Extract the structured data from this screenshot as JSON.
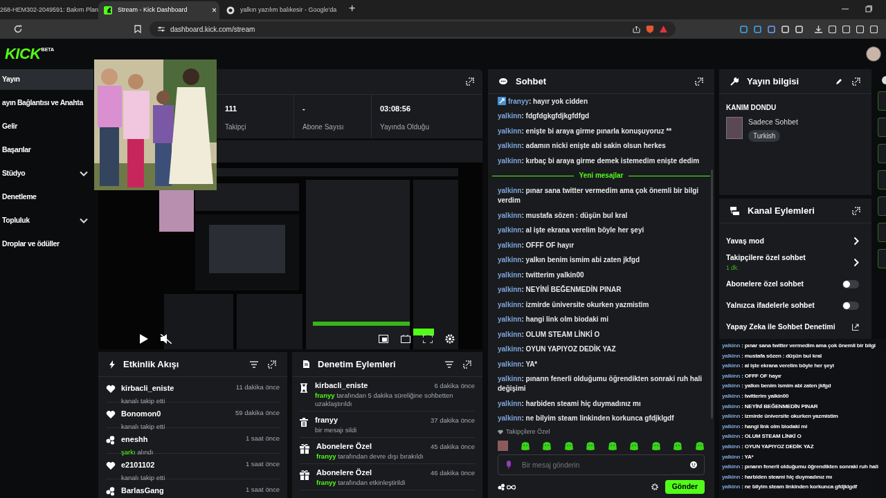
{
  "browser": {
    "tabs": [
      {
        "title": "268-HEM302-2049591: Bakım Plan",
        "selected": false,
        "kind": "page"
      },
      {
        "title": "Stream - Kick Dashboard",
        "selected": true,
        "kind": "kick",
        "close": "×"
      },
      {
        "title": "yalkın yazılım balıkesir - Google'da",
        "selected": false,
        "kind": "google"
      }
    ],
    "new_tab": "+",
    "url": "dashboard.kick.com/stream"
  },
  "header": {
    "logo": "KICK",
    "logo_badge": "BETA"
  },
  "sidebar": {
    "items": [
      {
        "label": "Yayın",
        "selected": true,
        "expandable": false
      },
      {
        "label": "ayın Bağlantısı ve Anahta",
        "selected": false,
        "expandable": false
      },
      {
        "label": "Gelir",
        "selected": false,
        "expandable": false
      },
      {
        "label": "Başarılar",
        "selected": false,
        "expandable": false
      },
      {
        "label": "Stüdyo",
        "selected": false,
        "expandable": true
      },
      {
        "label": "Denetleme",
        "selected": false,
        "expandable": false
      },
      {
        "label": "Topluluk",
        "selected": false,
        "expandable": true
      },
      {
        "label": "Droplar ve ödüller",
        "selected": false,
        "expandable": false
      }
    ]
  },
  "stats": {
    "items": [
      {
        "value": "111",
        "label": "Takipçi"
      },
      {
        "value": "-",
        "label": "Abone Sayısı"
      },
      {
        "value": "03:08:56",
        "label": "Yayında Olduğu"
      }
    ]
  },
  "activity_feed": {
    "title": "Etkinlik Akışı",
    "items": [
      {
        "kind": "follow",
        "name": "kirbacli_eniste",
        "time": "11 dakika önce",
        "text": "kanalı takip etti"
      },
      {
        "kind": "follow",
        "name": "Bonomon0",
        "time": "59 dakika önce",
        "text": "kanalı takip etti"
      },
      {
        "kind": "song",
        "name": "eneshh",
        "time": "1 saat önce",
        "highlight": "şarkı",
        "text": "alındı"
      },
      {
        "kind": "follow",
        "name": "e2101102",
        "time": "1 saat önce",
        "text": "kanalı takip etti"
      },
      {
        "kind": "song",
        "name": "BarlasGang",
        "time": "1 saat önce"
      }
    ]
  },
  "moderation": {
    "title": "Denetim Eylemleri",
    "items": [
      {
        "kind": "timeout",
        "name": "kirbacli_eniste",
        "time": "6 dakika önce",
        "actor": "franyy",
        "text": "tarafından 5 dakika süreliğine sohbetten uzaklaştırıldı"
      },
      {
        "kind": "delete",
        "name": "franyy",
        "time": "37 dakika önce",
        "text": "bir mesajı sildi"
      },
      {
        "kind": "gift",
        "name": "Abonelere Özel",
        "time": "45 dakika önce",
        "actor": "franyy",
        "text": "tarafından devre dışı bırakıldı"
      },
      {
        "kind": "gift",
        "name": "Abonelere Özel",
        "time": "46 dakika önce",
        "actor": "franyy",
        "text": "tarafından etkinleştirildi"
      }
    ]
  },
  "chat": {
    "title": "Sohbet",
    "earlier_messages": [
      {
        "user": "franyy",
        "text": "hayır yok cidden",
        "badge": true
      },
      {
        "user": "yalkinn",
        "text": "fdgfdgkgfdjkgfdfgd",
        "badge": false
      },
      {
        "user": "yalkinn",
        "text": "enişte bi araya girme pınarla konuşuyoruz **",
        "badge": false
      },
      {
        "user": "yalkinn",
        "text": "adamın nicki enişte abi sakin olsun herkes",
        "badge": false
      },
      {
        "user": "yalkinn",
        "text": "kırbaç bi araya girme demek istemedim enişte dedim",
        "badge": false
      }
    ],
    "divider": "Yeni mesajlar",
    "new_messages": [
      {
        "user": "yalkinn",
        "text": "pınar sana twitter vermedim ama çok önemli bir bilgi verdim",
        "badge": false
      },
      {
        "user": "yalkinn",
        "text": "mustafa sözen : düşün bul kral",
        "badge": false
      },
      {
        "user": "yalkinn",
        "text": "al işte ekrana verelim böyle her şeyi",
        "badge": false
      },
      {
        "user": "yalkinn",
        "text": "OFFF OF hayır",
        "badge": false
      },
      {
        "user": "yalkinn",
        "text": "yalkın benim ismim abi zaten jkfgd",
        "badge": false
      },
      {
        "user": "yalkinn",
        "text": "twitterim yalkin00",
        "badge": false
      },
      {
        "user": "yalkinn",
        "text": "NEYİNİ BEĞENMEDİN PINAR",
        "badge": false
      },
      {
        "user": "yalkinn",
        "text": "izmirde üniversite okurken yazmistim",
        "badge": false
      },
      {
        "user": "yalkinn",
        "text": "hangi link olm biodaki mi",
        "badge": false
      },
      {
        "user": "yalkinn",
        "text": "OLUM STEAM LİNKİ O",
        "badge": false
      },
      {
        "user": "yalkinn",
        "text": "OYUN YAPIYOZ DEDİK YAZ",
        "badge": false
      },
      {
        "user": "yalkinn",
        "text": "YA*",
        "badge": false
      },
      {
        "user": "yalkinn",
        "text": "pınarın fenerli olduğumu öğrendikten sonraki ruh hali değişimi",
        "badge": false
      },
      {
        "user": "yalkinn",
        "text": "harbiden steami hiç duymadınız mı",
        "badge": false
      },
      {
        "user": "yalkinn",
        "text": "ne bilyim steam linkinden korkunca gfdjklgdf",
        "badge": false
      }
    ],
    "separator": ":",
    "mode_label": "Takipçilere Özel",
    "placeholder": "Bir mesaj gönderin",
    "send": "Gönder"
  },
  "stream_info": {
    "title": "Yayın bilgisi",
    "stream_title": "KANIM DONDU",
    "category": "Sadece Sohbet",
    "tag": "Turkish"
  },
  "channel_actions": {
    "title": "Kanal Eylemleri",
    "items": [
      {
        "kind": "link",
        "label": "Yavaş mod"
      },
      {
        "kind": "link",
        "label": "Takipçilere özel sohbet",
        "sub": "1 dk."
      },
      {
        "kind": "toggle",
        "label": "Abonelere özel sohbet",
        "on": false
      },
      {
        "kind": "toggle",
        "label": "Yalnızca ifadelerle sohbet",
        "on": false
      },
      {
        "kind": "external",
        "label": "Yapay Zeka ile Sohbet Denetimi"
      }
    ]
  },
  "overlay_chat": {
    "separator": ":",
    "messages": [
      {
        "user": "yalkinn",
        "text": "pınar sana twitter vermedim ama çok önemli bir bilgi"
      },
      {
        "user": "yalkinn",
        "text": "mustafa sözen : düşün bul kral"
      },
      {
        "user": "yalkinn",
        "text": "al işte ekrana verelim böyle her şeyi"
      },
      {
        "user": "yalkinn",
        "text": "OFFF OF hayır"
      },
      {
        "user": "yalkinn",
        "text": "yalkın benim ismim abi zaten jkfgd"
      },
      {
        "user": "yalkinn",
        "text": "twitterim yalkin00"
      },
      {
        "user": "yalkinn",
        "text": "NEYİNİ BEĞENMEDİN PINAR"
      },
      {
        "user": "yalkinn",
        "text": "izmirde üniversite okurken yazmistim"
      },
      {
        "user": "yalkinn",
        "text": "hangi link olm biodaki mi"
      },
      {
        "user": "yalkinn",
        "text": "OLUM STEAM LİNKİ O"
      },
      {
        "user": "yalkinn",
        "text": "OYUN YAPIYOZ DEDİK YAZ"
      },
      {
        "user": "yalkinn",
        "text": "YA*"
      },
      {
        "user": "yalkinn",
        "text": "pınarın fenerli olduğumu öğrendikten sonraki ruh hali"
      },
      {
        "user": "yalkinn",
        "text": "harbiden steami hiç duymadınız mı"
      },
      {
        "user": "yalkinn",
        "text": "ne bilyim steam linkinden korkunca gfdjklgdf"
      }
    ]
  }
}
